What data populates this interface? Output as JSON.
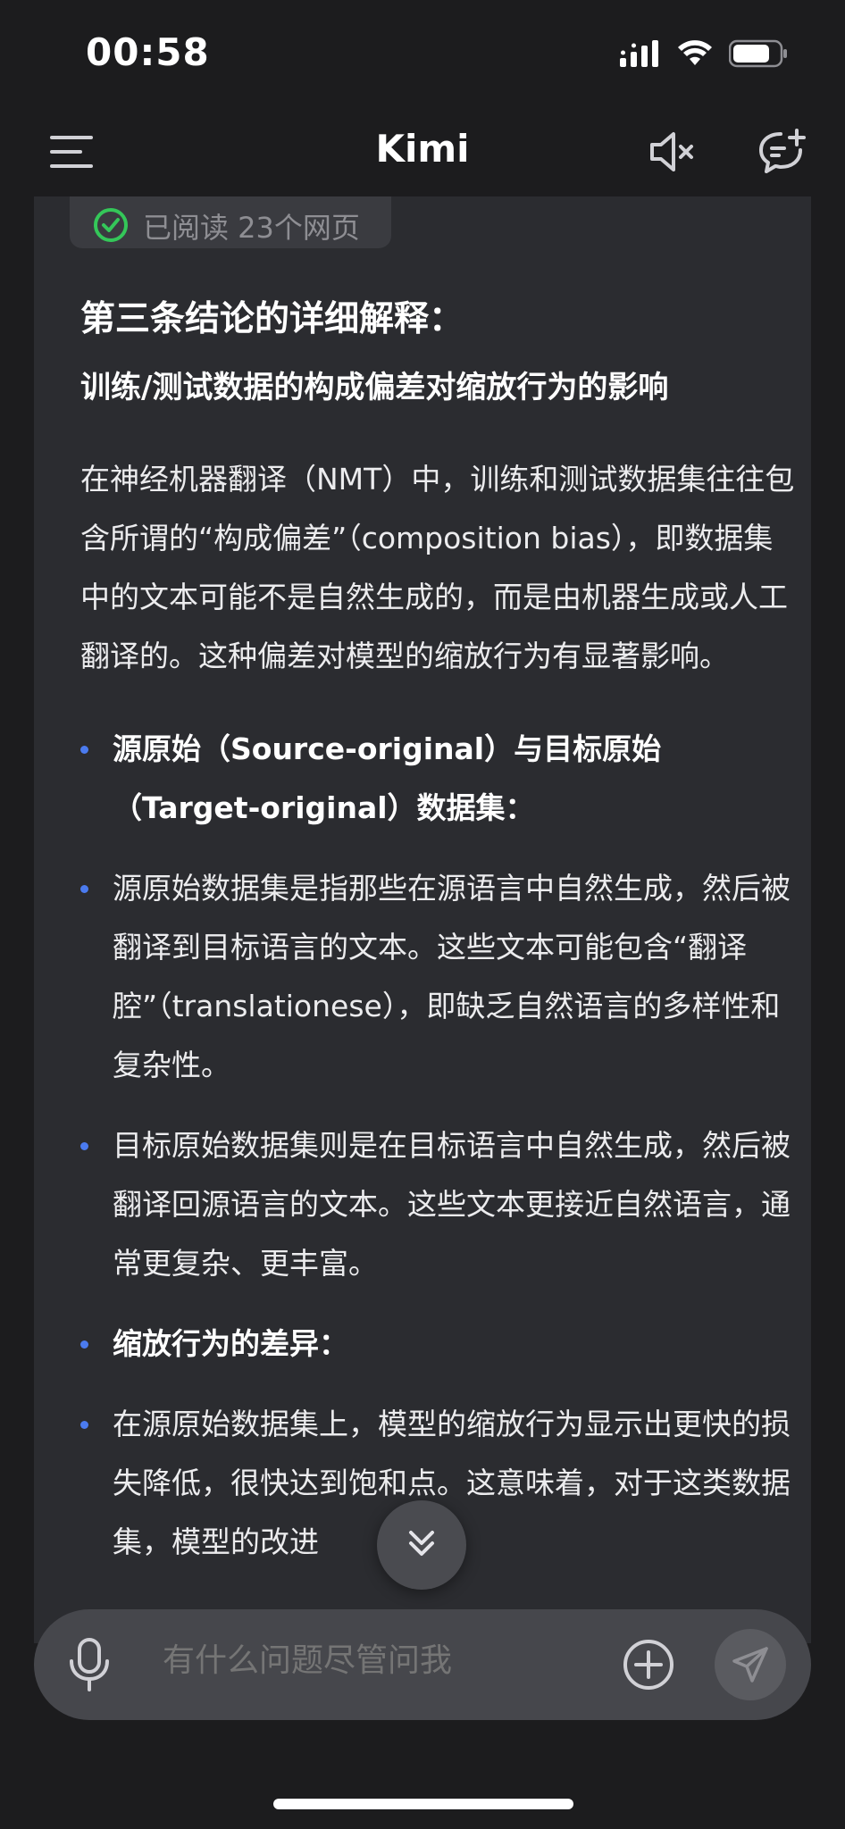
{
  "status_bar": {
    "time": "00:58"
  },
  "nav": {
    "title": "Kimi"
  },
  "sources": {
    "label": "已阅读 23个网页"
  },
  "article": {
    "heading": "第三条结论的详细解释：",
    "subheading": "训练/测试数据的构成偏差对缩放行为的影响",
    "intro": "在神经机器翻译（NMT）中，训练和测试数据集往往包含所谓的“构成偏差”（composition bias），即数据集中的文本可能不是自然生成的，而是由机器生成或人工翻译的。这种偏差对模型的缩放行为有显著影响。",
    "bullets": [
      {
        "text": "源原始（Source-original）与目标原始（Target-original）数据集：",
        "bold": true
      },
      {
        "text": "源原始数据集是指那些在源语言中自然生成，然后被翻译到目标语言的文本。这些文本可能包含“翻译腔”（translationese），即缺乏自然语言的多样性和复杂性。",
        "bold": false
      },
      {
        "text": "目标原始数据集则是在目标语言中自然生成，然后被翻译回源语言的文本。这些文本更接近自然语言，通常更复杂、更丰富。",
        "bold": false
      },
      {
        "text": "缩放行为的差异：",
        "bold": true
      },
      {
        "text": "在源原始数据集上，模型的缩放行为显示出更快的损失降低，很快达到饱和点。这意味着，对于这类数据集，模型的改进",
        "bold": false
      }
    ]
  },
  "input": {
    "placeholder": "有什么问题尽管问我"
  },
  "colors": {
    "background": "#1c1c1e",
    "card": "#2b2c30",
    "accent_bullet": "#4b7bef",
    "check_green": "#34c759"
  }
}
